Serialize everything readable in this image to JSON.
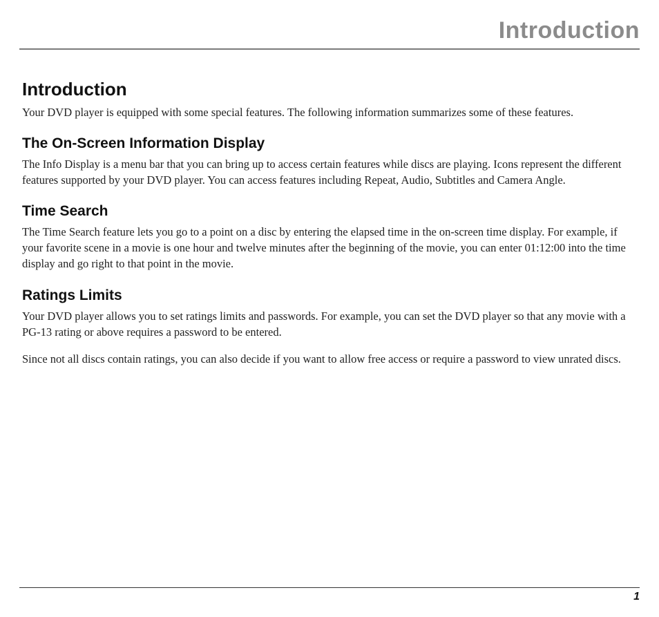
{
  "chapter_title": "Introduction",
  "sections": [
    {
      "heading": "Introduction",
      "level": "h1",
      "paragraphs": [
        "Your DVD player is equipped with some special features. The following information summarizes some of these features."
      ]
    },
    {
      "heading": "The On-Screen Information Display",
      "level": "h2",
      "paragraphs": [
        "The Info Display is a menu bar that you can bring up to access certain features while discs are playing. Icons represent the different features supported by your DVD player. You can access features including Repeat, Audio, Subtitles and Camera Angle."
      ]
    },
    {
      "heading": "Time Search",
      "level": "h2",
      "paragraphs": [
        "The Time Search feature lets you go to a point on a disc by entering the elapsed time in the on-screen time display. For example, if your favorite scene in a movie is one hour and twelve minutes after the beginning of the movie, you can enter 01:12:00 into the time display and go right to that point in the movie."
      ]
    },
    {
      "heading": "Ratings Limits",
      "level": "h2",
      "paragraphs": [
        "Your DVD player allows you to set ratings limits and passwords. For example, you can set the DVD player so that any movie with a PG-13 rating or above requires a password to be entered.",
        "Since not all discs contain ratings, you can also decide if you want to allow free access or require a password to view unrated discs."
      ]
    }
  ],
  "page_number": "1"
}
